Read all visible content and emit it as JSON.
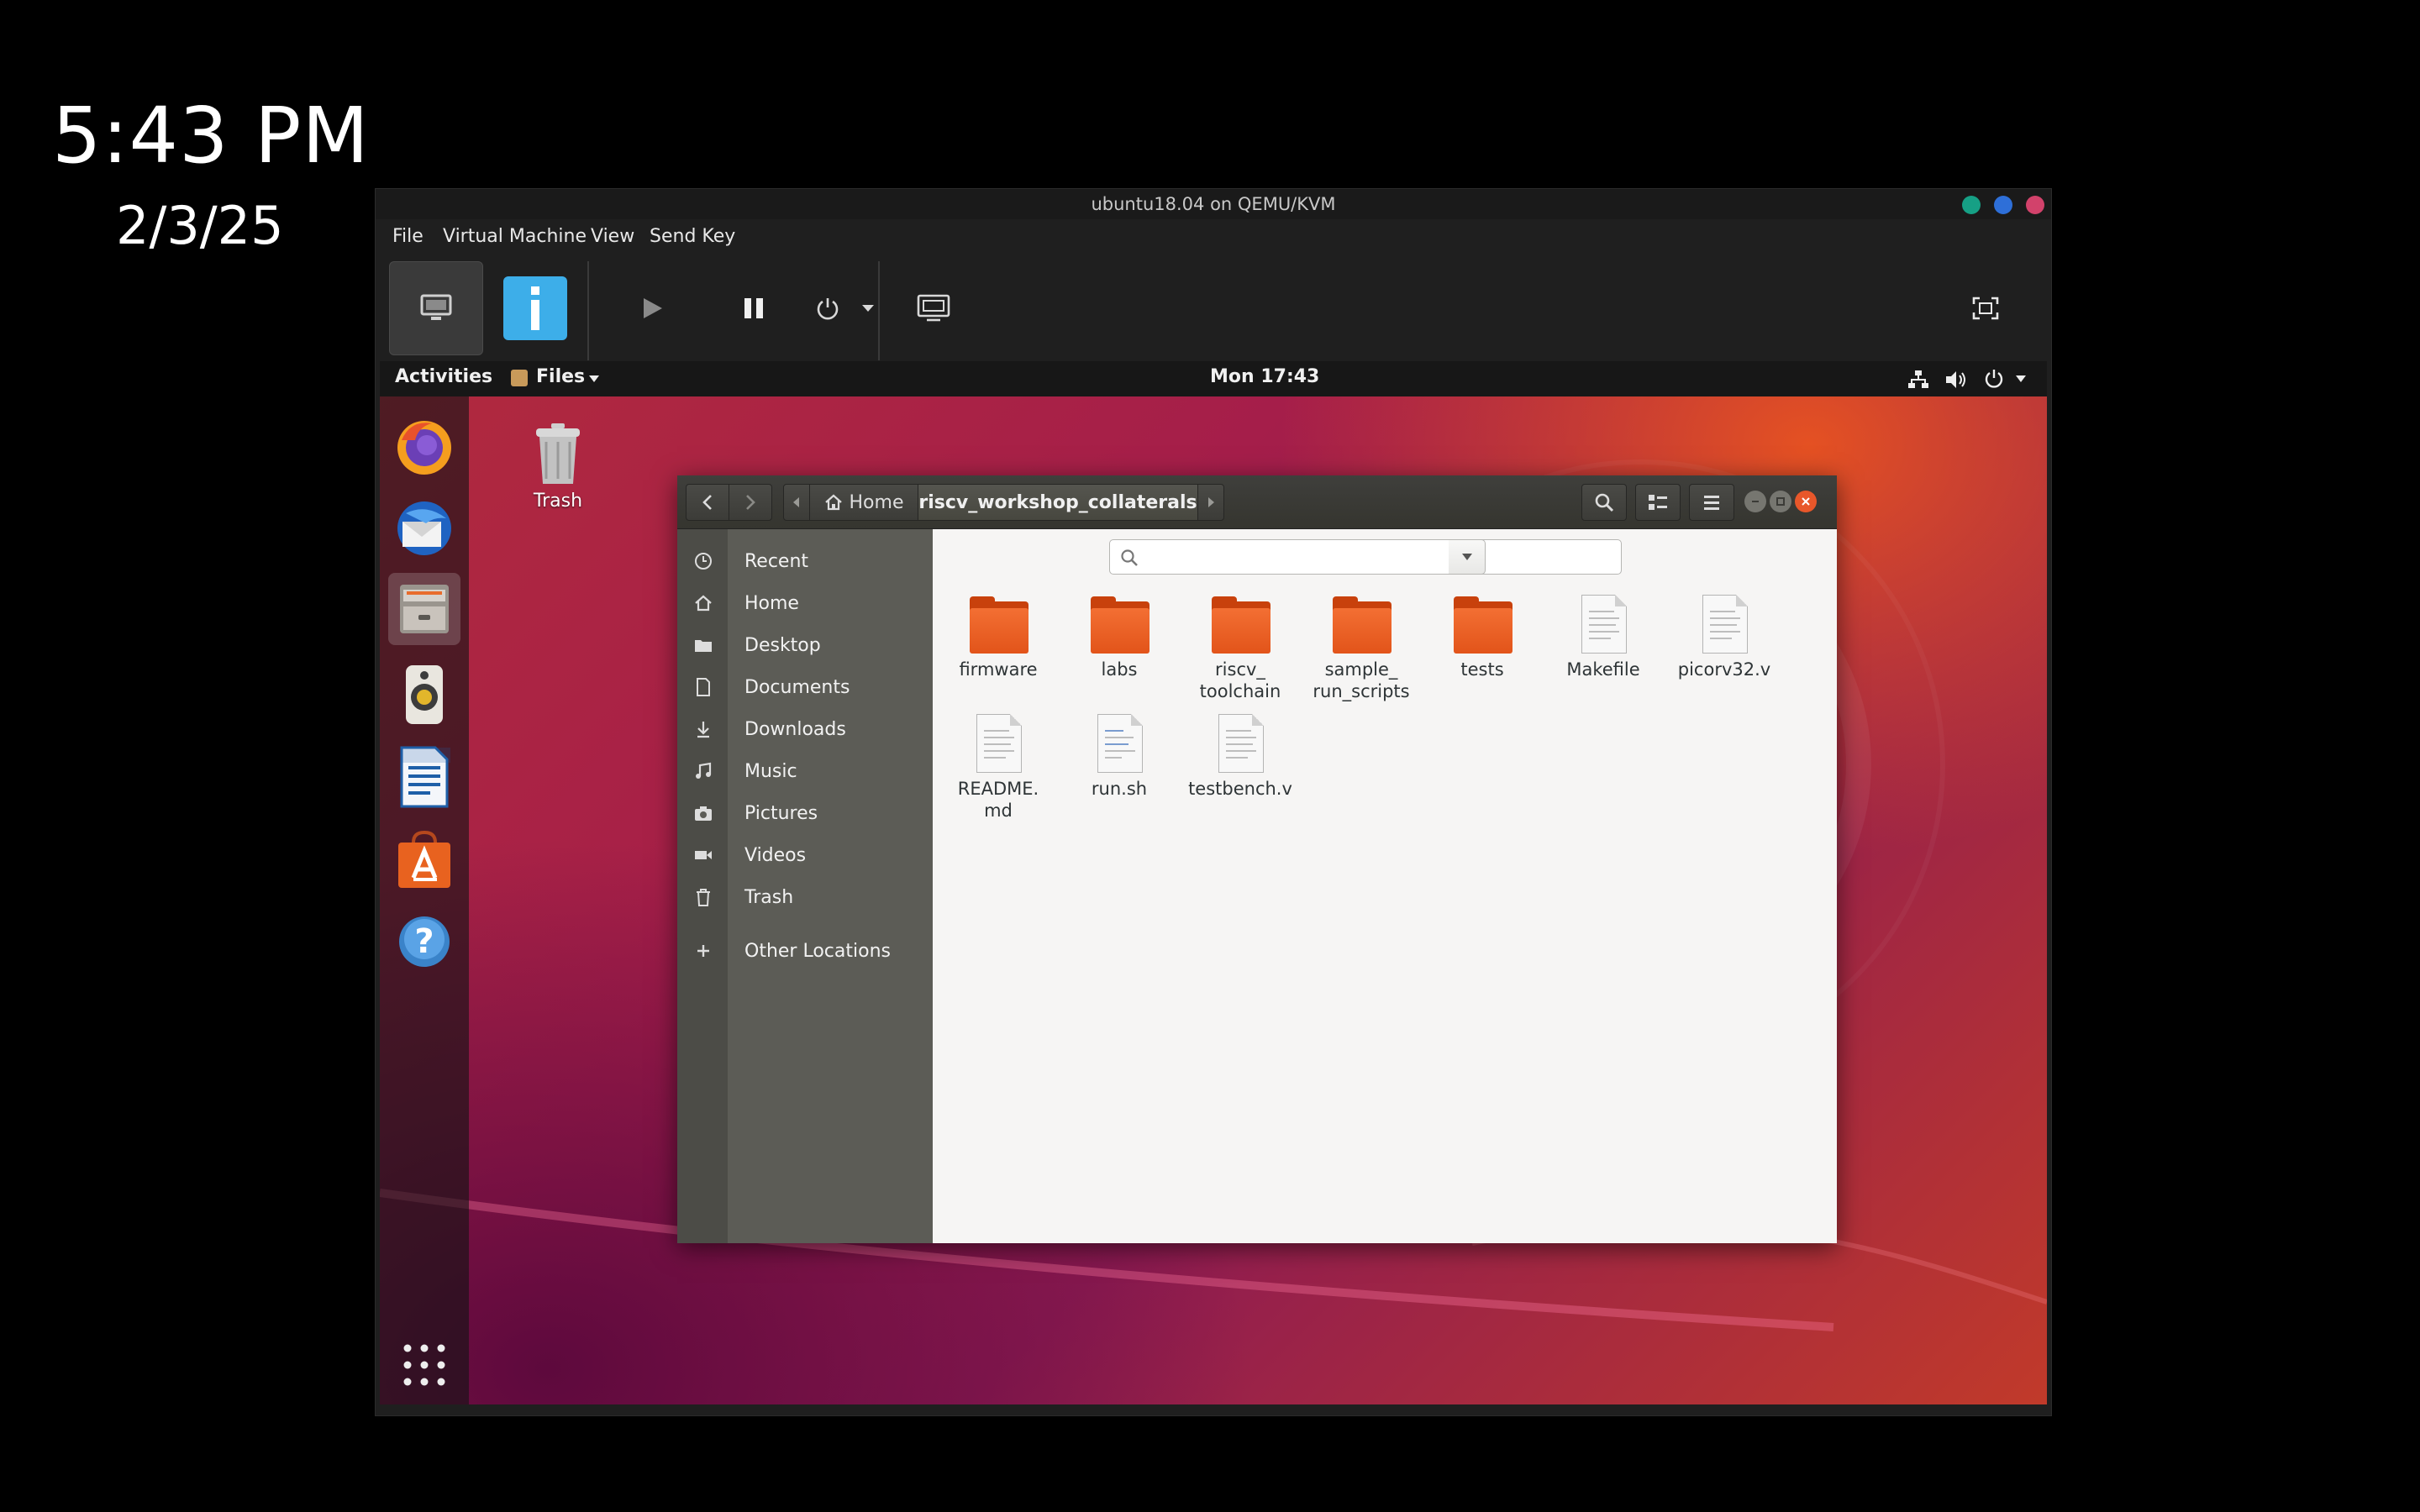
{
  "host": {
    "time": "5:43 PM",
    "date": "2/3/25"
  },
  "vm": {
    "title": "ubuntu18.04 on QEMU/KVM",
    "menu": [
      "File",
      "Virtual Machine",
      "View",
      "Send Key"
    ],
    "colors": {
      "accent": "#3daee9",
      "btn_teal": "#16a085",
      "btn_blue": "#2e6fd8",
      "btn_red": "#d2426b"
    }
  },
  "guest": {
    "activities": "Activities",
    "app_menu": "Files",
    "clock": "Mon 17:43",
    "dock_icons": [
      "firefox-icon",
      "thunderbird-icon",
      "files-icon",
      "rhythmbox-icon",
      "libreoffice-writer-icon",
      "ubuntu-software-icon",
      "help-icon",
      "show-apps-icon"
    ],
    "desktop_trash": "Trash"
  },
  "files": {
    "path": {
      "home": "Home",
      "current": "riscv_workshop_collaterals"
    },
    "sidebar": [
      {
        "label": "Recent",
        "icon": "clock-icon"
      },
      {
        "label": "Home",
        "icon": "home-icon"
      },
      {
        "label": "Desktop",
        "icon": "folder-icon"
      },
      {
        "label": "Documents",
        "icon": "document-icon"
      },
      {
        "label": "Downloads",
        "icon": "download-icon"
      },
      {
        "label": "Music",
        "icon": "music-icon"
      },
      {
        "label": "Pictures",
        "icon": "camera-icon"
      },
      {
        "label": "Videos",
        "icon": "video-icon"
      },
      {
        "label": "Trash",
        "icon": "trash-icon"
      },
      {
        "label": "Other Locations",
        "icon": "plus-icon"
      }
    ],
    "items": [
      {
        "name": "firmware",
        "type": "folder"
      },
      {
        "name": "labs",
        "type": "folder"
      },
      {
        "name": "riscv_\ntoolchain",
        "type": "folder"
      },
      {
        "name": "sample_\nrun_scripts",
        "type": "folder"
      },
      {
        "name": "tests",
        "type": "folder"
      },
      {
        "name": "Makefile",
        "type": "file"
      },
      {
        "name": "picorv32.v",
        "type": "file"
      },
      {
        "name": "README.\nmd",
        "type": "file"
      },
      {
        "name": "run.sh",
        "type": "file"
      },
      {
        "name": "testbench.v",
        "type": "file"
      }
    ]
  }
}
